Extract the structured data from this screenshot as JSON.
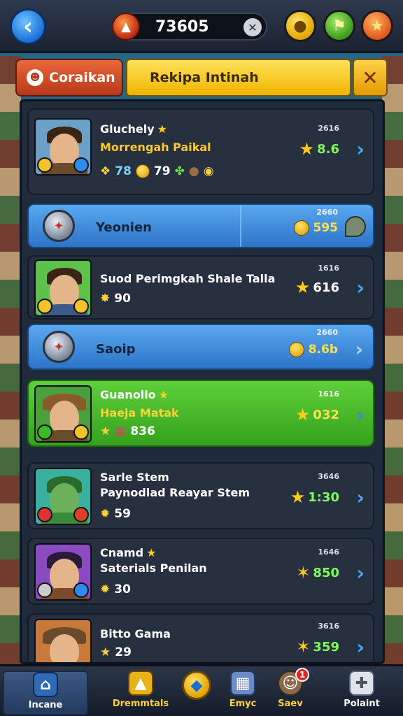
{
  "topbar": {
    "back_icon": "back-arrow-icon",
    "currency_value": "73605",
    "buttons": [
      "coin-icon",
      "flag-icon",
      "star-icon"
    ]
  },
  "tabs": {
    "left_label": "Coraikan",
    "right_label": "Rekipa Intinah",
    "close_label": "✕"
  },
  "rows": [
    {
      "type": "player",
      "name": "Gluchely",
      "subtitle": "Morrengah Paikal",
      "stats": [
        "78",
        "79"
      ],
      "tiny": "2616",
      "score": "8.6",
      "score_green": true
    },
    {
      "type": "section",
      "label": "Yeonien",
      "tiny": "2660",
      "score": "595"
    },
    {
      "type": "player",
      "name": "Suod Perimgkah Shale Talla",
      "subtitle": "",
      "stats": [
        "90"
      ],
      "tiny": "1616",
      "score": "616",
      "score_green": false
    },
    {
      "type": "section",
      "label": "Saoip",
      "tiny": "2660",
      "score": "8.6b"
    },
    {
      "type": "player",
      "name": "Guanollo",
      "subtitle": "Haeja Matak",
      "stats": [
        "836"
      ],
      "tiny": "1616",
      "score": "032",
      "score_green": false
    },
    {
      "type": "player",
      "name": "Sarle Stem",
      "subtitle": "Paynodlad Reayar Stem",
      "stats": [
        "59"
      ],
      "tiny": "3646",
      "score": "1:30",
      "score_green": true
    },
    {
      "type": "player",
      "name": "Cnamd",
      "subtitle": "Saterials Penilan",
      "stats": [
        "30"
      ],
      "tiny": "1646",
      "score": "850",
      "score_green": true
    },
    {
      "type": "player",
      "name": "Bitto Gama",
      "subtitle": "",
      "stats": [
        "29"
      ],
      "tiny": "3616",
      "score": "359",
      "score_green": true
    }
  ],
  "nav": [
    {
      "label": "Incane",
      "icon": "home-icon"
    },
    {
      "label": "Dremmtals",
      "icon": "treasure-icon"
    },
    {
      "label": "",
      "icon": "gem-icon"
    },
    {
      "label": "Emyc",
      "icon": "map-icon"
    },
    {
      "label": "Saev",
      "icon": "profile-icon",
      "badge": "1"
    },
    {
      "label": "Polaint",
      "icon": "puzzle-icon"
    }
  ],
  "colors": {
    "accent_blue": "#2d74c8",
    "accent_green": "#35a11d",
    "accent_gold": "#f0b400",
    "accent_red": "#b8371a"
  }
}
